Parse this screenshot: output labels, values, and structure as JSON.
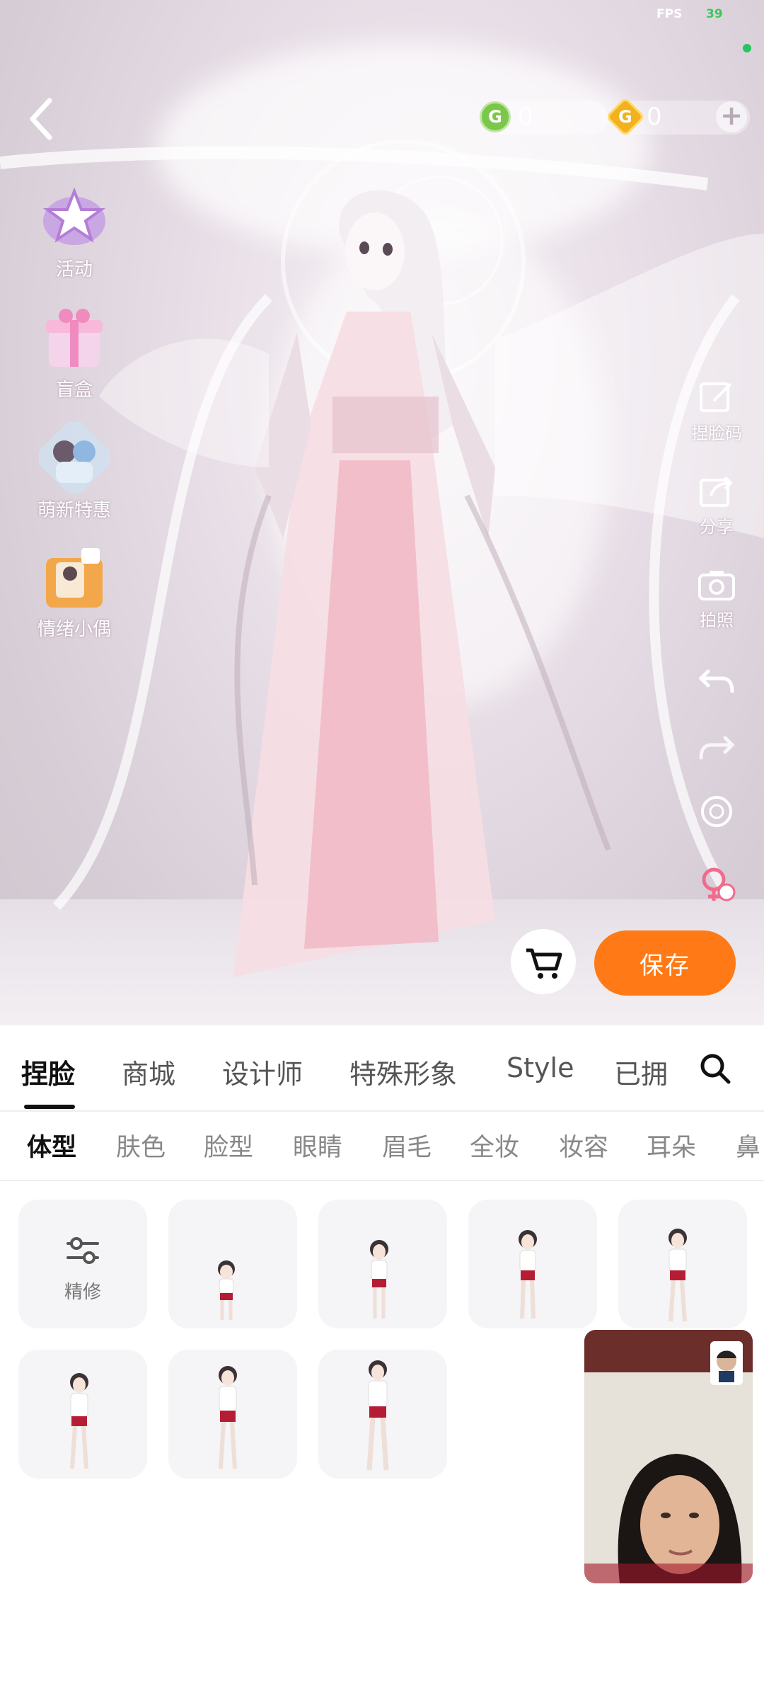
{
  "status": {
    "fps_label": "FPS",
    "fps_value": "39"
  },
  "currency": {
    "green_value": "0",
    "gold_value": "0",
    "green_icon": "g-coin-icon",
    "gold_icon": "gold-coin-icon"
  },
  "left_menu": [
    {
      "label": "活动",
      "icon": "star-badge-icon"
    },
    {
      "label": "盲盒",
      "icon": "gift-box-icon"
    },
    {
      "label": "萌新特惠",
      "icon": "characters-icon"
    },
    {
      "label": "情绪小偶",
      "icon": "figurine-box-icon"
    }
  ],
  "right_tools": {
    "face_code": "捏脸码",
    "share": "分享",
    "photo": "拍照"
  },
  "actions": {
    "save_label": "保存"
  },
  "tabs": [
    "捏脸",
    "商城",
    "设计师",
    "特殊形象",
    "Style",
    "已拥"
  ],
  "subtabs": [
    "体型",
    "肤色",
    "脸型",
    "眼睛",
    "眉毛",
    "全妆",
    "妆容",
    "耳朵",
    "鼻"
  ],
  "refine_label": "精修",
  "colors": {
    "accent": "#ff7a16",
    "active_text": "#111111"
  }
}
